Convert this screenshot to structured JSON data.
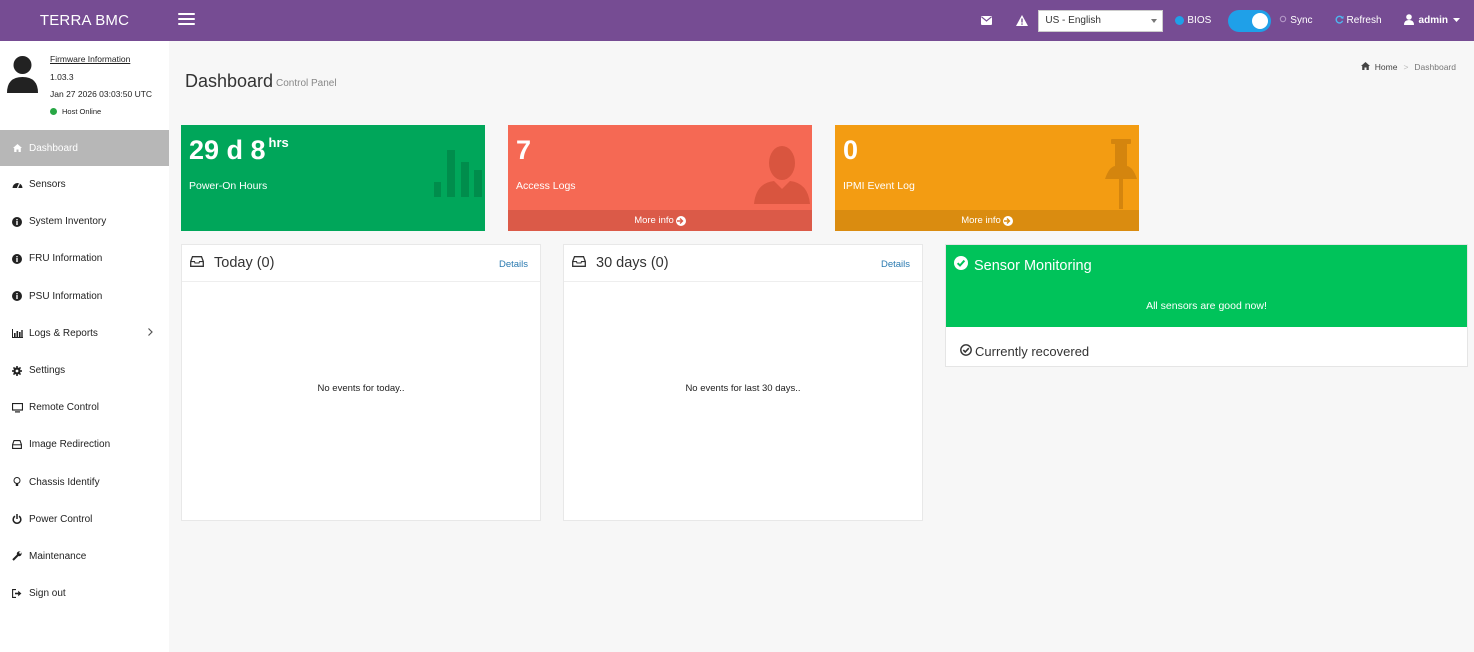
{
  "brand": "TERRA BMC",
  "topbar": {
    "language": "US - English",
    "bios_label": "BIOS",
    "sync_label": "Sync",
    "refresh_label": "Refresh",
    "user_label": "admin"
  },
  "user_panel": {
    "firmware_title": "Firmware Information",
    "firmware_version": "1.03.3",
    "datetime": "Jan 27 2026 03:03:50 UTC",
    "host_status": "Host Online"
  },
  "sidebar": {
    "items": [
      {
        "label": "Dashboard",
        "icon": "dashboard-icon"
      },
      {
        "label": "Sensors",
        "icon": "tachometer-icon"
      },
      {
        "label": "System Inventory",
        "icon": "info-icon"
      },
      {
        "label": "FRU Information",
        "icon": "info-icon"
      },
      {
        "label": "PSU Information",
        "icon": "info-icon"
      },
      {
        "label": "Logs & Reports",
        "icon": "bar-chart-icon"
      },
      {
        "label": "Settings",
        "icon": "gear-icon"
      },
      {
        "label": "Remote Control",
        "icon": "monitor-icon"
      },
      {
        "label": "Image Redirection",
        "icon": "drive-icon"
      },
      {
        "label": "Chassis Identify",
        "icon": "lightbulb-icon"
      },
      {
        "label": "Power Control",
        "icon": "power-icon"
      },
      {
        "label": "Maintenance",
        "icon": "wrench-icon"
      },
      {
        "label": "Sign out",
        "icon": "sign-out-icon"
      }
    ]
  },
  "page": {
    "title": "Dashboard",
    "subtitle": "Control Panel",
    "breadcrumb_home": "Home",
    "breadcrumb_current": "Dashboard"
  },
  "stats": {
    "power_on": {
      "value": "29 d 8",
      "unit": "hrs",
      "label": "Power-On Hours",
      "color": "#00a65a"
    },
    "access_logs": {
      "value": "7",
      "label": "Access Logs",
      "footer": "More info",
      "color": "#f56954",
      "footer_color": "#db5a48"
    },
    "ipmi": {
      "value": "0",
      "label": "IPMI Event Log",
      "footer": "More info",
      "color": "#f39c12",
      "footer_color": "#da8c10"
    }
  },
  "today_panel": {
    "title": "Today (0)",
    "details": "Details",
    "empty": "No events for today.."
  },
  "days30_panel": {
    "title": "30 days (0)",
    "details": "Details",
    "empty": "No events for last 30 days.."
  },
  "sensor": {
    "title": "Sensor Monitoring",
    "message": "All sensors are good now!",
    "recovered": "Currently recovered",
    "color": "#00c35a"
  }
}
